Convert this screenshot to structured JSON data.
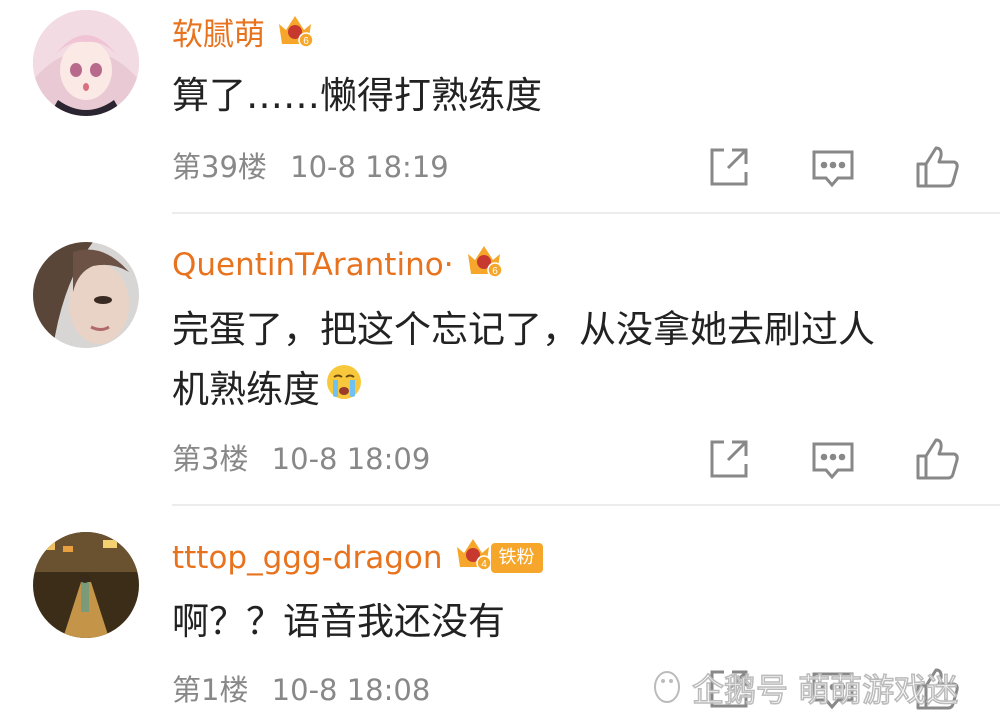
{
  "comments": [
    {
      "username": "软腻萌",
      "crown_level": "6",
      "fan_badge": "",
      "text_lines": [
        "算了……懒得打熟练度"
      ],
      "floor": "第39楼",
      "time": "10-8 18:19"
    },
    {
      "username": "QuentinTArantino·",
      "crown_level": "6",
      "fan_badge": "",
      "text_lines": [
        "完蛋了，把这个忘记了，从没拿她去刷过人",
        "机熟练度"
      ],
      "floor": "第3楼",
      "time": "10-8 18:09"
    },
    {
      "username": "tttop_ggg-dragon",
      "crown_level": "4",
      "fan_badge": "铁粉",
      "text_lines": [
        "啊？？语音我还没有"
      ],
      "floor": "第1楼",
      "time": "10-8 18:08"
    }
  ],
  "watermark": {
    "text": "企鹅号 萌萌游戏迷"
  },
  "colors": {
    "username": "#e8731f",
    "crown": "#f6a72b",
    "meta": "#888888",
    "icon": "#888888"
  },
  "icons": [
    "share-icon",
    "comment-icon",
    "like-icon",
    "crying-emoji-icon",
    "crown-badge-icon",
    "penguin-icon"
  ]
}
